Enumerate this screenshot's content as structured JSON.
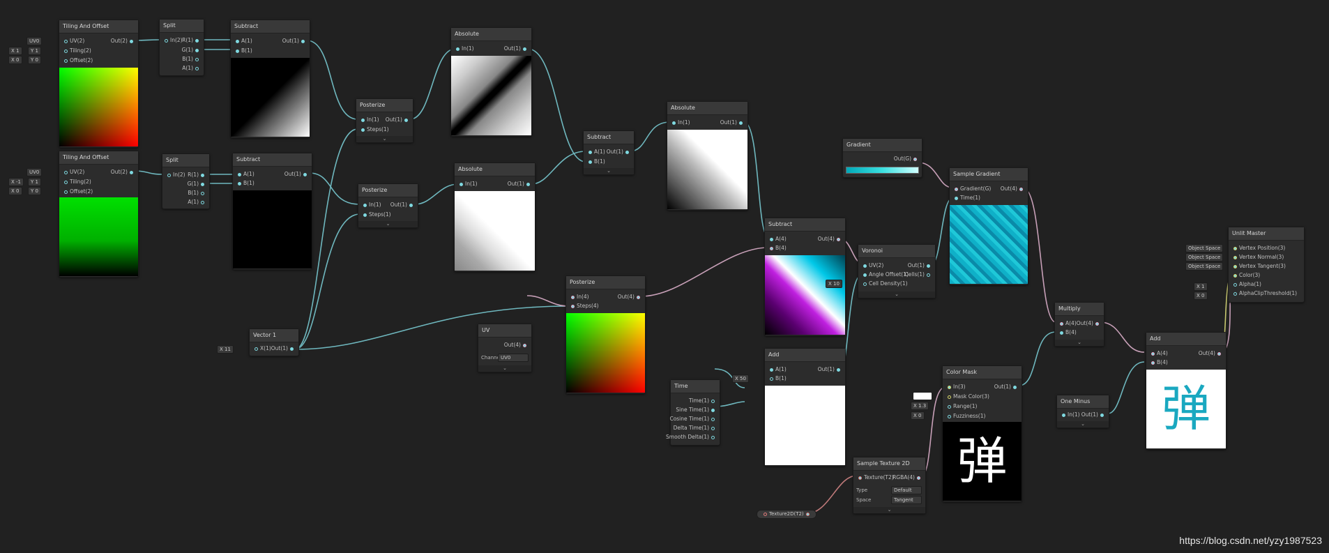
{
  "nodes": {
    "tiling1": {
      "title": "Tiling And Offset",
      "in": [
        "UV(2)",
        "Tiling(2)",
        "Offset(2)"
      ],
      "out": "Out(2)"
    },
    "tiling2": {
      "title": "Tiling And Offset",
      "in": [
        "UV(2)",
        "Tiling(2)",
        "Offset(2)"
      ],
      "out": "Out(2)"
    },
    "split1": {
      "title": "Split",
      "in": "In(2)",
      "out": [
        "R(1)",
        "G(1)",
        "B(1)",
        "A(1)"
      ]
    },
    "split2": {
      "title": "Split",
      "in": "In(2)",
      "out": [
        "R(1)",
        "G(1)",
        "B(1)",
        "A(1)"
      ]
    },
    "sub1": {
      "title": "Subtract",
      "in": [
        "A(1)",
        "B(1)"
      ],
      "out": "Out(1)"
    },
    "sub2": {
      "title": "Subtract",
      "in": [
        "A(1)",
        "B(1)"
      ],
      "out": "Out(1)"
    },
    "post1": {
      "title": "Posterize",
      "in": [
        "In(1)",
        "Steps(1)"
      ],
      "out": "Out(1)"
    },
    "post2": {
      "title": "Posterize",
      "in": [
        "In(1)",
        "Steps(1)"
      ],
      "out": "Out(1)"
    },
    "abs1": {
      "title": "Absolute",
      "in": "In(1)",
      "out": "Out(1)"
    },
    "abs2": {
      "title": "Absolute",
      "in": "In(1)",
      "out": "Out(1)"
    },
    "sub3": {
      "title": "Subtract",
      "in": [
        "A(1)",
        "B(1)"
      ],
      "out": "Out(1)"
    },
    "abs3": {
      "title": "Absolute",
      "in": "In(1)",
      "out": "Out(1)"
    },
    "vec1": {
      "title": "Vector 1",
      "in": "X(1)",
      "out": "Out(1)",
      "x": "11"
    },
    "uv": {
      "title": "UV",
      "out": "Out(4)",
      "channel_label": "Channe",
      "channel": "UV0"
    },
    "post3": {
      "title": "Posterize",
      "in": [
        "In(4)",
        "Steps(4)"
      ],
      "out": "Out(4)"
    },
    "time": {
      "title": "Time",
      "out": [
        "Time(1)",
        "Sine Time(1)",
        "Cosine Time(1)",
        "Delta Time(1)",
        "Smooth Delta(1)"
      ]
    },
    "sub4": {
      "title": "Subtract",
      "in": [
        "A(4)",
        "B(4)"
      ],
      "out": "Out(4)"
    },
    "add1": {
      "title": "Add",
      "in": [
        "A(1)",
        "B(1)"
      ],
      "out": "Out(1)",
      "b": "50"
    },
    "voronoi": {
      "title": "Voronoi",
      "in": [
        "UV(2)",
        "Angle Offset(1)",
        "Cell Density(1)"
      ],
      "out": [
        "Out(1)",
        "Cells(1)"
      ],
      "density": "10"
    },
    "gradient": {
      "title": "Gradient",
      "out": "Out(G)"
    },
    "sgrad": {
      "title": "Sample Gradient",
      "in": [
        "Gradient(G)",
        "Time(1)"
      ],
      "out": "Out(4)"
    },
    "colormask": {
      "title": "Color Mask",
      "in": [
        "In(3)",
        "Mask Color(3)",
        "Range(1)",
        "Fuzziness(1)"
      ],
      "out": "Out(1)",
      "range": "1.3",
      "fuzz": "0"
    },
    "stex": {
      "title": "Sample Texture 2D",
      "in": "Texture(T2)",
      "out": "RGBA(4)",
      "type_label": "Type",
      "type": "Default",
      "space_label": "Space",
      "space": "Tangent"
    },
    "tex2d": {
      "title": "Texture2D(T2)"
    },
    "multiply": {
      "title": "Multiply",
      "in": [
        "A(4)",
        "B(4)"
      ],
      "out": "Out(4)"
    },
    "oneminus": {
      "title": "One Minus",
      "in": "In(1)",
      "out": "Out(1)"
    },
    "add2": {
      "title": "Add",
      "in": [
        "A(4)",
        "B(4)"
      ],
      "out": "Out(4)"
    },
    "unlit": {
      "title": "Unlit Master",
      "in": [
        "Vertex Position(3)",
        "Vertex Normal(3)",
        "Vertex Tangent(3)",
        "Color(3)",
        "Alpha(1)",
        "AlphaClipThreshold(1)"
      ],
      "space": "Object Space",
      "alpha": "1",
      "clip": "0"
    }
  },
  "inputs": {
    "uv0": "UV0",
    "t1_tiling": {
      "x": "1",
      "y": "1"
    },
    "t1_offset": {
      "x": "0",
      "y": "0"
    },
    "t2_tiling": {
      "x": "-1",
      "y": "1"
    },
    "t2_offset": {
      "x": "0",
      "y": "0"
    },
    "axis_x": "X",
    "axis_y": "Y"
  },
  "glyph": "弹",
  "watermark": "https://blog.csdn.net/yzy1987523",
  "colors": {
    "wire_blue": "#6fb8bf",
    "wire_pink": "#c8a0b8",
    "wire_red": "#c07a7a",
    "wire_yellow": "#c8c870"
  }
}
